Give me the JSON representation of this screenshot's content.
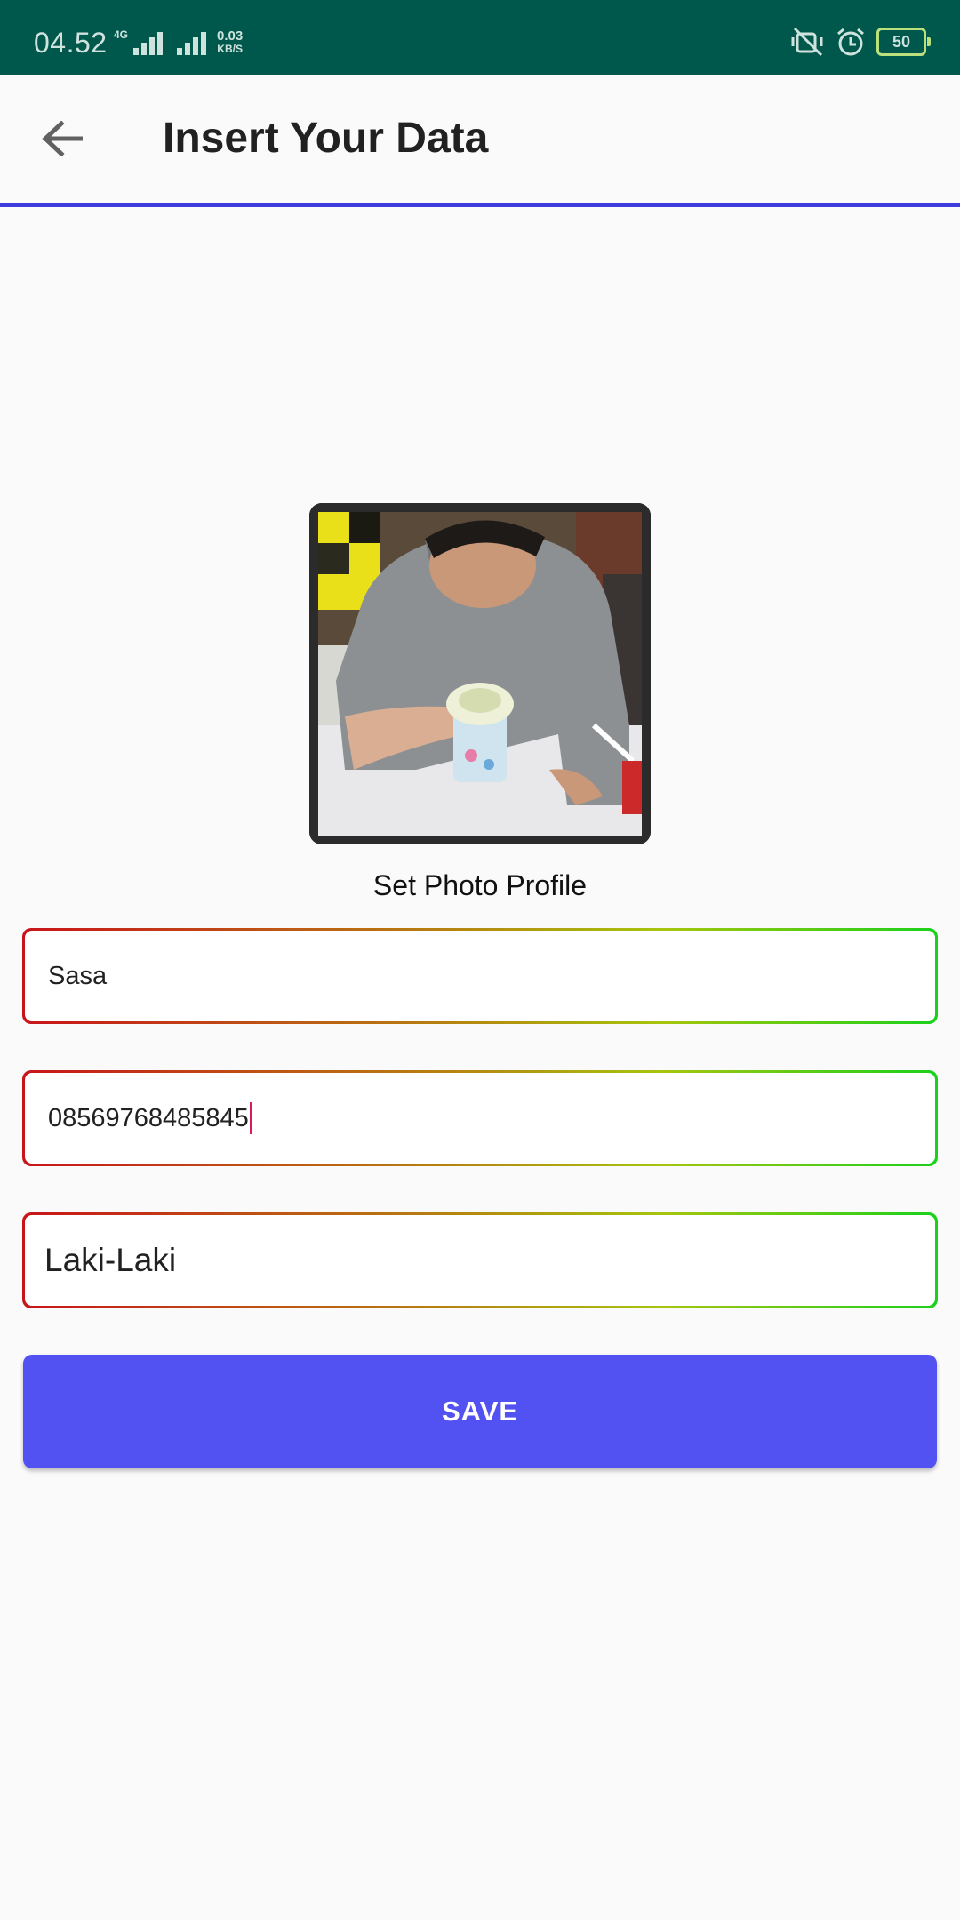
{
  "status_bar": {
    "time": "04.52",
    "network_type": "4G",
    "net_speed_value": "0.03",
    "net_speed_unit": "KB/S",
    "battery_level": "50",
    "icons": [
      "vibrate-off-icon",
      "alarm-icon",
      "battery-icon"
    ]
  },
  "app_bar": {
    "title": "Insert Your Data",
    "back_icon": "arrow-back-icon"
  },
  "profile": {
    "caption": "Set Photo Profile",
    "photo_icon": "profile-photo"
  },
  "form": {
    "name_value": "Sasa",
    "phone_value": "08569768485845",
    "gender_value": "Laki-Laki",
    "border_gradient": [
      "#c8141a",
      "#b77f10",
      "#a6c50e",
      "#1ad11a"
    ]
  },
  "actions": {
    "save_label": "SAVE"
  },
  "colors": {
    "status_bar": "#00574b",
    "accent_line": "#3d3ddf",
    "save_button": "#5252f2",
    "cursor": "#d81b60",
    "background": "#fafafa"
  }
}
